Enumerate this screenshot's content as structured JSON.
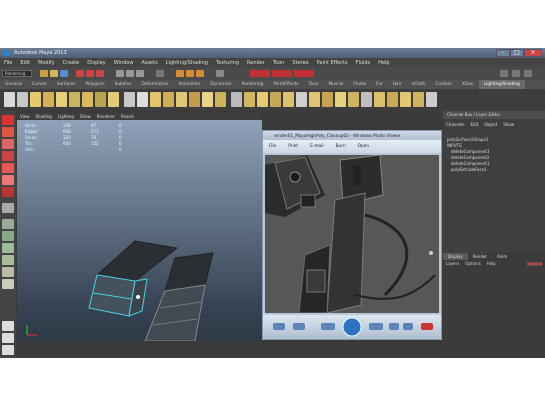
{
  "window": {
    "title": "Autodesk Maya 2013"
  },
  "menubar": {
    "items": [
      "File",
      "Edit",
      "Modify",
      "Create",
      "Display",
      "Window",
      "Assets",
      "Lighting/Shading",
      "Texturing",
      "Render",
      "Toon",
      "Stereo",
      "Paint Effects",
      "Fluids",
      "Help"
    ]
  },
  "statusline": {
    "mode": "Rendering"
  },
  "shelf": {
    "tabs": [
      "General",
      "Curves",
      "Surfaces",
      "Polygons",
      "Subdivs",
      "Deformation",
      "Animation",
      "Dynamics",
      "Rendering",
      "PaintEffects",
      "Toon",
      "Muscle",
      "Fluids",
      "Fur",
      "Hair",
      "nCloth",
      "Custom",
      "XGen",
      "Lighting/Shading"
    ],
    "active_tab": "Lighting/Shading"
  },
  "viewport": {
    "menu": [
      "View",
      "Shading",
      "Lighting",
      "Show",
      "Renderer",
      "Panels"
    ],
    "hud": [
      {
        "label": "Verts:",
        "a": "348",
        "b": "97",
        "c": "0"
      },
      {
        "label": "Edges:",
        "a": "668",
        "b": "171",
        "c": "0"
      },
      {
        "label": "Faces:",
        "a": "320",
        "b": "76",
        "c": "0"
      },
      {
        "label": "Tris:",
        "a": "640",
        "b": "152",
        "c": "0"
      },
      {
        "label": "UVs:",
        "a": "",
        "b": "",
        "c": "0"
      }
    ]
  },
  "image_window": {
    "title": "render01_MayaHighPoly_Closeup02 - Windows Photo Viewer",
    "menu": [
      "File",
      "Print",
      "E-mail",
      "Burn",
      "Open"
    ]
  },
  "channel_box": {
    "title": "Channel Box / Layer Editor",
    "menu": [
      "Channels",
      "Edit",
      "Object",
      "Show"
    ],
    "items": [
      "polySurface1Shape1",
      "INPUTS",
      "deleteComponent3",
      "deleteComponent2",
      "deleteComponent1",
      "polyExtrudeFace1"
    ]
  },
  "layer_editor": {
    "tabs": [
      "Display",
      "Render",
      "Anim"
    ],
    "active_tab": "Display",
    "menu": [
      "Layers",
      "Options",
      "Help"
    ]
  },
  "colors": {
    "accent": "#4aa3ff",
    "selection": "#49d1e6"
  }
}
